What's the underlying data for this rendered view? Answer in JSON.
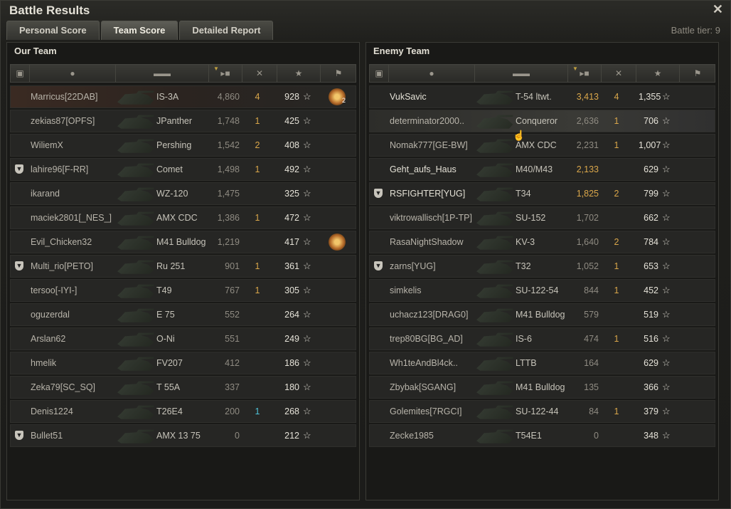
{
  "window": {
    "title": "Battle Results",
    "close": "✕",
    "tier": "Battle tier: 9"
  },
  "tabs": [
    "Personal Score",
    "Team Score",
    "Detailed Report"
  ],
  "our_team": {
    "title": "Our Team",
    "rows": [
      {
        "player": "Marricus[22DAB]",
        "tank": "IS-3A",
        "damage": "4,860",
        "kills": "4",
        "xp": "928",
        "platoon": false,
        "medal": "2",
        "me": true
      },
      {
        "player": "zekias87[OPFS]",
        "tank": "JPanther",
        "damage": "1,748",
        "kills": "1",
        "xp": "425",
        "platoon": false
      },
      {
        "player": "WiliemX",
        "tank": "Pershing",
        "damage": "1,542",
        "kills": "2",
        "xp": "408",
        "platoon": false
      },
      {
        "player": "lahire96[F-RR]",
        "tank": "Comet",
        "damage": "1,498",
        "kills": "1",
        "xp": "492",
        "platoon": true
      },
      {
        "player": "ikarand",
        "tank": "WZ-120",
        "damage": "1,475",
        "kills": "",
        "xp": "325",
        "platoon": false
      },
      {
        "player": "maciek2801[_NES_]",
        "tank": "AMX CDC",
        "damage": "1,386",
        "kills": "1",
        "xp": "472",
        "platoon": false
      },
      {
        "player": "Evil_Chicken32",
        "tank": "M41 Bulldog",
        "damage": "1,219",
        "kills": "",
        "xp": "417",
        "platoon": false,
        "medal": ""
      },
      {
        "player": "Multi_rio[PETO]",
        "tank": "Ru 251",
        "damage": "901",
        "kills": "1",
        "xp": "361",
        "platoon": true
      },
      {
        "player": "tersoo[-IYI-]",
        "tank": "T49",
        "damage": "767",
        "kills": "1",
        "xp": "305",
        "platoon": false
      },
      {
        "player": "oguzerdal",
        "tank": "E 75",
        "damage": "552",
        "kills": "",
        "xp": "264",
        "platoon": false
      },
      {
        "player": "Arslan62",
        "tank": "O-Ni",
        "damage": "551",
        "kills": "",
        "xp": "249",
        "platoon": false
      },
      {
        "player": "hmelik",
        "tank": "FV207",
        "damage": "412",
        "kills": "",
        "xp": "186",
        "platoon": false
      },
      {
        "player": "Zeka79[SC_SQ]",
        "tank": "T 55A",
        "damage": "337",
        "kills": "",
        "xp": "180",
        "platoon": false
      },
      {
        "player": "Denis1224",
        "tank": "T26E4",
        "damage": "200",
        "kills": "1",
        "xp": "268",
        "platoon": false,
        "blue": true
      },
      {
        "player": "Bullet51",
        "tank": "AMX 13 75",
        "damage": "0",
        "kills": "",
        "xp": "212",
        "platoon": true
      }
    ]
  },
  "enemy_team": {
    "title": "Enemy Team",
    "rows": [
      {
        "player": "VukSavic",
        "tank": "T-54 ltwt.",
        "damage": "3,413",
        "kills": "4",
        "xp": "1,355",
        "platoon": false,
        "gold": true,
        "bright": true
      },
      {
        "player": "determinator2000..",
        "tank": "Conqueror",
        "damage": "2,636",
        "kills": "1",
        "xp": "706",
        "platoon": false,
        "hl": true
      },
      {
        "player": "Nomak777[GE-BW]",
        "tank": "AMX CDC",
        "damage": "2,231",
        "kills": "1",
        "xp": "1,007",
        "platoon": false
      },
      {
        "player": "Geht_aufs_Haus",
        "tank": "M40/M43",
        "damage": "2,133",
        "kills": "",
        "xp": "629",
        "platoon": false,
        "gold": true,
        "bright": true
      },
      {
        "player": "RSFIGHTER[YUG]",
        "tank": "T34",
        "damage": "1,825",
        "kills": "2",
        "xp": "799",
        "platoon": true,
        "gold": true,
        "bright": true
      },
      {
        "player": "viktrowallisch[1P-TP]",
        "tank": "SU-152",
        "damage": "1,702",
        "kills": "",
        "xp": "662",
        "platoon": false
      },
      {
        "player": "RasaNightShadow",
        "tank": "KV-3",
        "damage": "1,640",
        "kills": "2",
        "xp": "784",
        "platoon": false
      },
      {
        "player": "zarns[YUG]",
        "tank": "T32",
        "damage": "1,052",
        "kills": "1",
        "xp": "653",
        "platoon": true
      },
      {
        "player": "simkelis",
        "tank": "SU-122-54",
        "damage": "844",
        "kills": "1",
        "xp": "452",
        "platoon": false
      },
      {
        "player": "uchacz123[DRAG0]",
        "tank": "M41 Bulldog",
        "damage": "579",
        "kills": "",
        "xp": "519",
        "platoon": false
      },
      {
        "player": "trep80BG[BG_AD]",
        "tank": "IS-6",
        "damage": "474",
        "kills": "1",
        "xp": "516",
        "platoon": false
      },
      {
        "player": "Wh1teAndBl4ck..",
        "tank": "LTTB",
        "damage": "164",
        "kills": "",
        "xp": "629",
        "platoon": false
      },
      {
        "player": "Zbybak[SGANG]",
        "tank": "M41 Bulldog",
        "damage": "135",
        "kills": "",
        "xp": "366",
        "platoon": false
      },
      {
        "player": "Golemites[7RGCI]",
        "tank": "SU-122-44",
        "damage": "84",
        "kills": "1",
        "xp": "379",
        "platoon": false
      },
      {
        "player": "Zecke1985",
        "tank": "T54E1",
        "damage": "0",
        "kills": "",
        "xp": "348",
        "platoon": false
      }
    ]
  },
  "columns": [
    "platoon-icon",
    "player-icon",
    "tank-icon",
    "damage-icon",
    "kills-icon",
    "xp-icon",
    "medal-icon"
  ],
  "colors": {
    "gold": "#d9a64a",
    "blue": "#4fc3d8",
    "background": "#1e1e1b"
  }
}
